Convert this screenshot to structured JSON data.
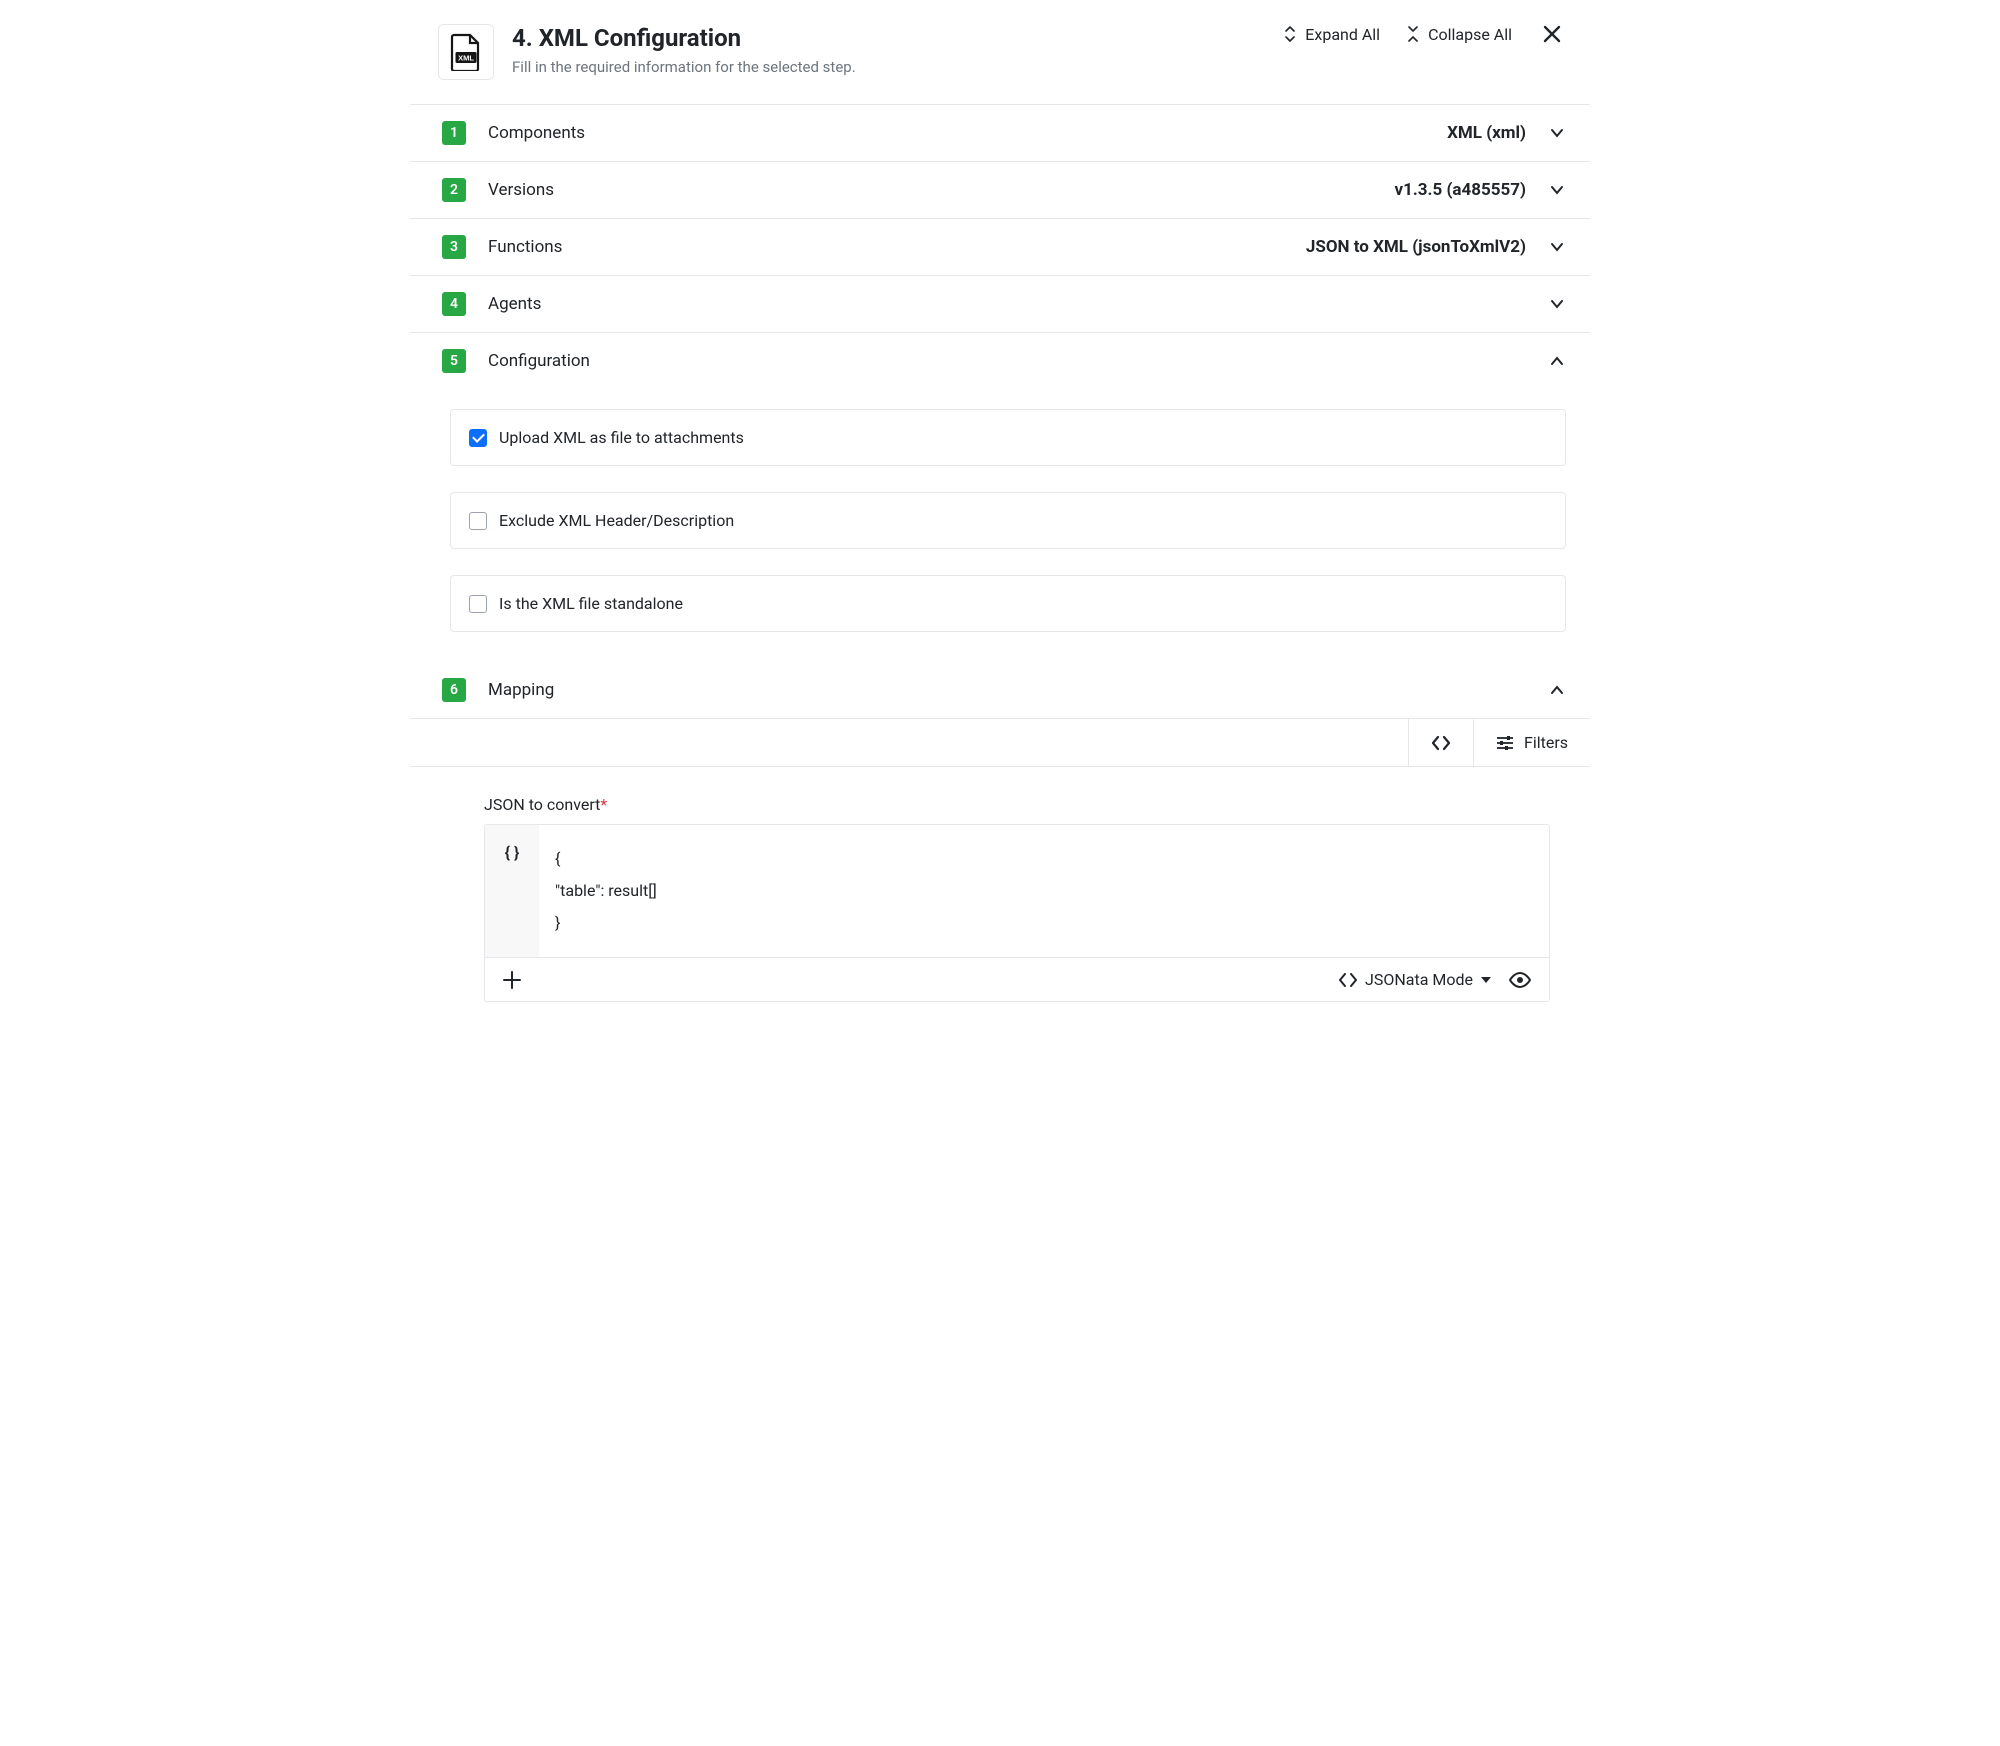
{
  "header": {
    "title": "4. XML Configuration",
    "subtitle": "Fill in the required information for the selected step.",
    "expand": "Expand All",
    "collapse": "Collapse All"
  },
  "sections": {
    "s1": {
      "num": "1",
      "label": "Components",
      "value": "XML (xml)"
    },
    "s2": {
      "num": "2",
      "label": "Versions",
      "value": "v1.3.5 (a485557)"
    },
    "s3": {
      "num": "3",
      "label": "Functions",
      "value": "JSON to XML (jsonToXmlV2)"
    },
    "s4": {
      "num": "4",
      "label": "Agents",
      "value": ""
    },
    "s5": {
      "num": "5",
      "label": "Configuration",
      "value": ""
    },
    "s6": {
      "num": "6",
      "label": "Mapping",
      "value": ""
    }
  },
  "config": {
    "opt1": {
      "label": "Upload XML as file to attachments",
      "checked": true
    },
    "opt2": {
      "label": "Exclude XML Header/Description",
      "checked": false
    },
    "opt3": {
      "label": "Is the XML file standalone",
      "checked": false
    }
  },
  "mapping": {
    "filters_label": "Filters",
    "field_label": "JSON to convert",
    "code": "{\n\"table\": result[]\n}",
    "mode_label": "JSONata Mode"
  }
}
